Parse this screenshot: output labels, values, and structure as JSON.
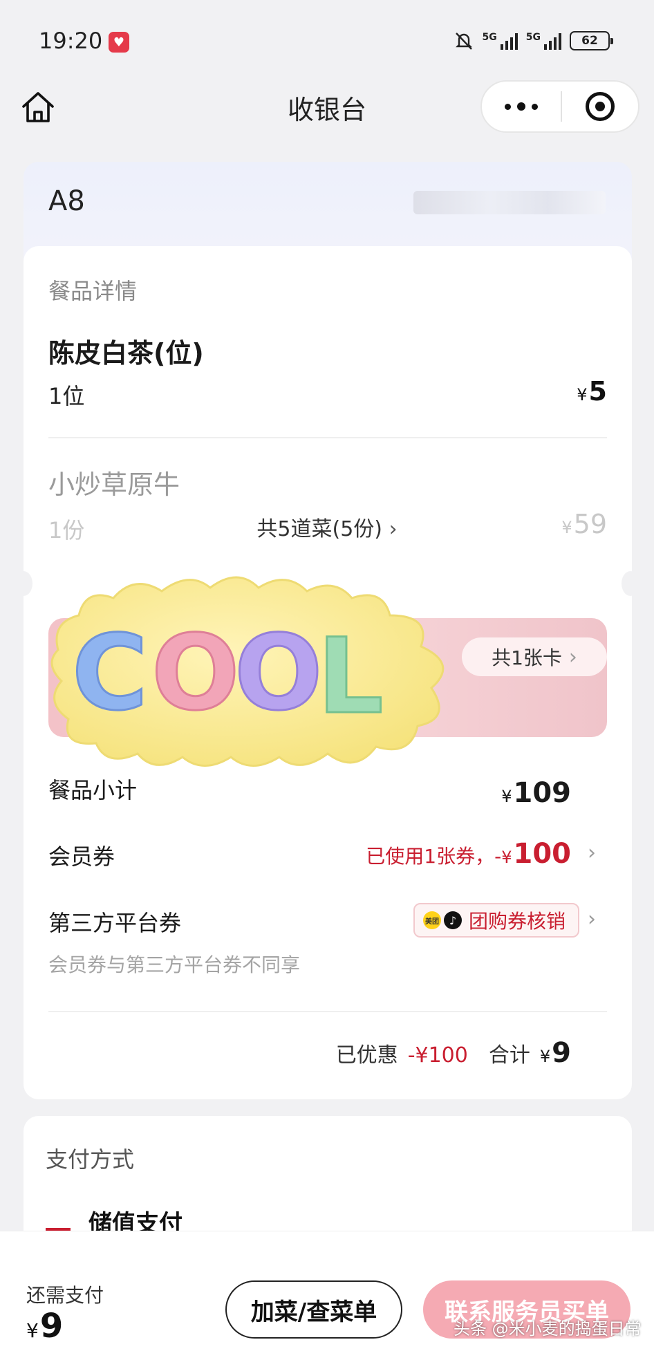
{
  "status_bar": {
    "time": "19:20",
    "signal_1": "5G",
    "signal_2": "5G",
    "battery": "62"
  },
  "nav": {
    "title": "收银台"
  },
  "table": {
    "number": "A8"
  },
  "details": {
    "section_label": "餐品详情",
    "items": [
      {
        "name": "陈皮白茶(位)",
        "qty": "1位",
        "price": "5"
      },
      {
        "name": "小炒草原牛",
        "qty": "1份",
        "price": "59"
      }
    ],
    "more_link": "共5道菜(5份)"
  },
  "member_card": {
    "pill": "共1张卡",
    "sticker_text": "COOL"
  },
  "summary": {
    "subtotal_label": "餐品小计",
    "subtotal": "109",
    "member_coupon_label": "会员券",
    "member_coupon_value_prefix": "已使用1张券，-",
    "member_coupon_value": "100",
    "third_party_label": "第三方平台券",
    "third_party_chip": "团购券核销",
    "meituan_text": "美团",
    "note": "会员券与第三方平台券不同享",
    "discount_label": "已优惠",
    "discount_value": "-¥100",
    "total_label": "合计",
    "total": "9"
  },
  "payment": {
    "section_label": "支付方式",
    "method": "储值支付"
  },
  "bottom": {
    "need_label": "还需支付",
    "need_amount": "9",
    "add_button": "加菜/查菜单",
    "call_button": "联系服务员买单"
  },
  "currency": "¥",
  "watermark": "头条 @米小麦的捣蛋日常",
  "colors": {
    "accent_red": "#c91e30",
    "call_button_bg": "#f5aab3",
    "card_strip": "#f3c2c8"
  }
}
